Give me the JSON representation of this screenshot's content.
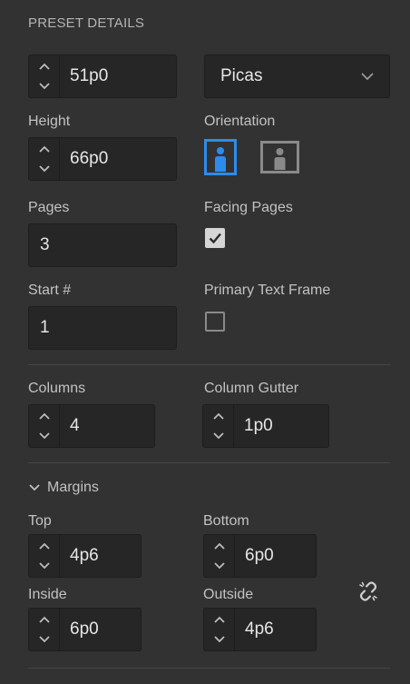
{
  "panel": {
    "section_title": "PRESET DETAILS",
    "width": {
      "value": "51p0"
    },
    "units": {
      "selected": "Picas"
    },
    "height": {
      "label": "Height",
      "value": "66p0"
    },
    "orientation": {
      "label": "Orientation",
      "selected": "portrait"
    },
    "pages": {
      "label": "Pages",
      "value": "3"
    },
    "facing_pages": {
      "label": "Facing Pages",
      "checked": true
    },
    "start_number": {
      "label": "Start #",
      "value": "1"
    },
    "primary_text_frame": {
      "label": "Primary Text Frame",
      "checked": false
    },
    "columns": {
      "label": "Columns",
      "value": "4"
    },
    "column_gutter": {
      "label": "Column Gutter",
      "value": "1p0"
    },
    "margins": {
      "title": "Margins",
      "expanded": true,
      "top": {
        "label": "Top",
        "value": "4p6"
      },
      "bottom": {
        "label": "Bottom",
        "value": "6p0"
      },
      "inside": {
        "label": "Inside",
        "value": "6p0"
      },
      "outside": {
        "label": "Outside",
        "value": "4p6"
      },
      "linked": false
    }
  },
  "colors": {
    "accent": "#2d8ceb",
    "background": "#323232",
    "field": "#262626"
  }
}
